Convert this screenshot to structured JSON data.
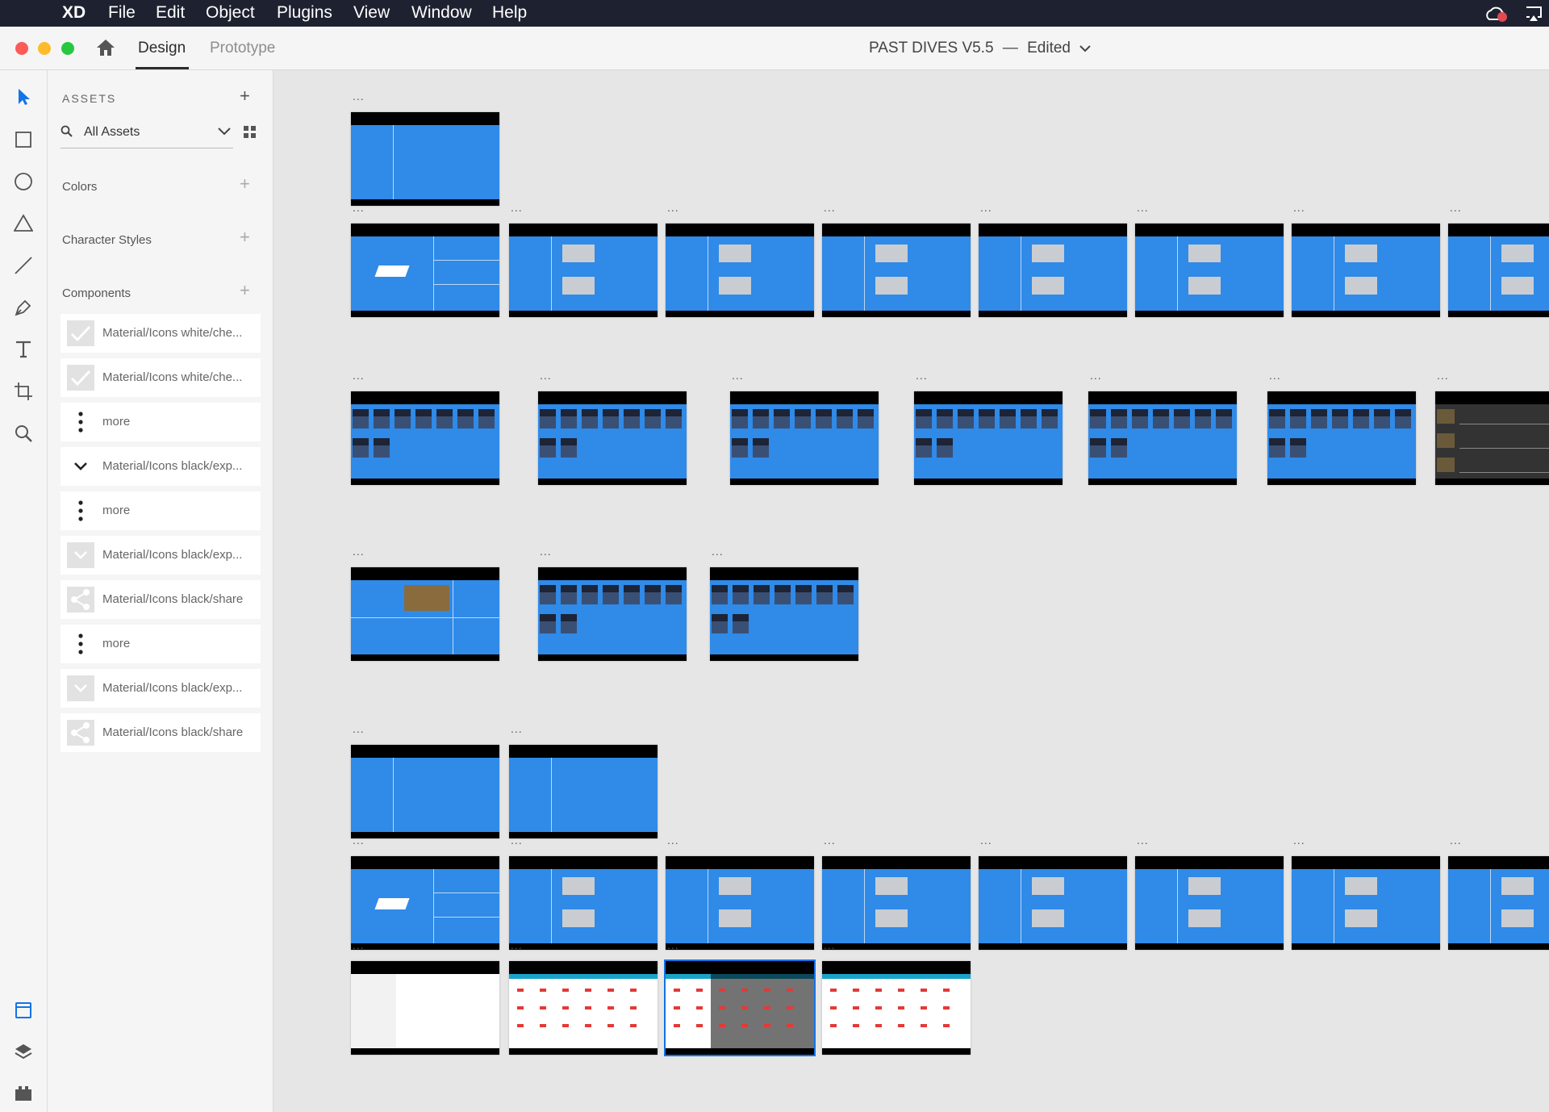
{
  "menubar": {
    "app": "XD",
    "items": [
      "File",
      "Edit",
      "Object",
      "Plugins",
      "View",
      "Window",
      "Help"
    ]
  },
  "titlebar": {
    "tabs": [
      {
        "label": "Design",
        "active": true
      },
      {
        "label": "Prototype",
        "active": false
      }
    ],
    "doc_title": "PAST DIVES V5.5",
    "separator": "—",
    "status": "Edited"
  },
  "assets": {
    "header": "ASSETS",
    "filter": "All Assets",
    "sections": [
      "Colors",
      "Character Styles",
      "Components"
    ],
    "components": [
      {
        "label": "Material/Icons white/che...",
        "icon": "check-icon"
      },
      {
        "label": "Material/Icons white/che...",
        "icon": "check-icon"
      },
      {
        "label": "more",
        "icon": "more-vertical-icon"
      },
      {
        "label": "Material/Icons black/exp...",
        "icon": "chevron-down-icon"
      },
      {
        "label": "more",
        "icon": "more-vertical-icon"
      },
      {
        "label": "Material/Icons black/exp...",
        "icon": "chevron-down-icon"
      },
      {
        "label": "Material/Icons black/share",
        "icon": "share-icon"
      },
      {
        "label": "more",
        "icon": "more-vertical-icon"
      },
      {
        "label": "Material/Icons black/exp...",
        "icon": "chevron-down-icon"
      },
      {
        "label": "Material/Icons black/share",
        "icon": "share-icon"
      }
    ]
  },
  "artboard_menu_label": "...",
  "colors": {
    "accent": "#1473e6",
    "artboard_blue": "#2f8ae8",
    "menubar": "#1e2230"
  }
}
